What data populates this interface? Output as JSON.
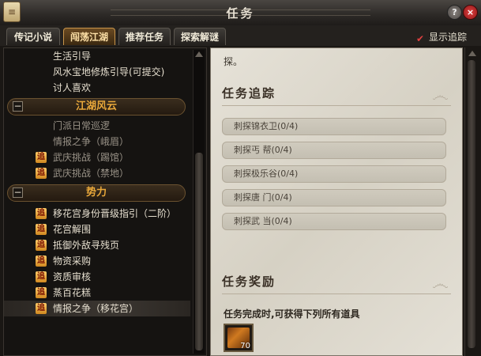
{
  "window": {
    "title": "任务",
    "help_label": "?",
    "close_label": "×"
  },
  "tabs": [
    {
      "label": "传记小说",
      "active": false
    },
    {
      "label": "闯荡江湖",
      "active": true
    },
    {
      "label": "推荐任务",
      "active": false
    },
    {
      "label": "探索解谜",
      "active": false
    }
  ],
  "track_toggle": {
    "label": "显示追踪",
    "checked": true
  },
  "quest_list": {
    "badge": "追",
    "top_items": [
      "生活引导",
      "风水宝地修炼引导(可提交)",
      "讨人喜欢"
    ],
    "section1": {
      "label": "江湖风云",
      "collapse": "−"
    },
    "section1_items": [
      {
        "label": "门派日常巡逻",
        "tracked": false
      },
      {
        "label": "情报之争（峨眉）",
        "tracked": false
      },
      {
        "label": "武庆挑战（踢馆）",
        "tracked": true
      },
      {
        "label": "武庆挑战（禁地）",
        "tracked": true
      }
    ],
    "section2": {
      "label": "势力",
      "collapse": "−"
    },
    "section2_items": [
      {
        "label": "移花宫身份晋级指引（二阶）",
        "tracked": true
      },
      {
        "label": "花宫解围",
        "tracked": true
      },
      {
        "label": "抵御外敌寻残页",
        "tracked": true
      },
      {
        "label": "物资采购",
        "tracked": true
      },
      {
        "label": "资质审核",
        "tracked": true
      },
      {
        "label": "蒸百花糕",
        "tracked": true
      },
      {
        "label": "情报之争（移花宫）",
        "tracked": true,
        "selected": true
      }
    ]
  },
  "detail": {
    "top_text": "探。",
    "tracking_title": "任务追踪",
    "objectives": [
      "刺探锦衣卫(0/4)",
      "刺探丐 帮(0/4)",
      "刺探极乐谷(0/4)",
      "刺探唐 门(0/4)",
      "刺探武 当(0/4)"
    ],
    "reward_title": "任务奖励",
    "reward_text": "任务完成时,可获得下列所有道具",
    "reward_item": {
      "icon": "scroll-item-icon",
      "quantity": "70"
    }
  },
  "colors": {
    "accent_orange": "#e9a83a",
    "badge_bg": "#d08820",
    "parchment": "#e2ded3",
    "close_red": "#c02020"
  }
}
